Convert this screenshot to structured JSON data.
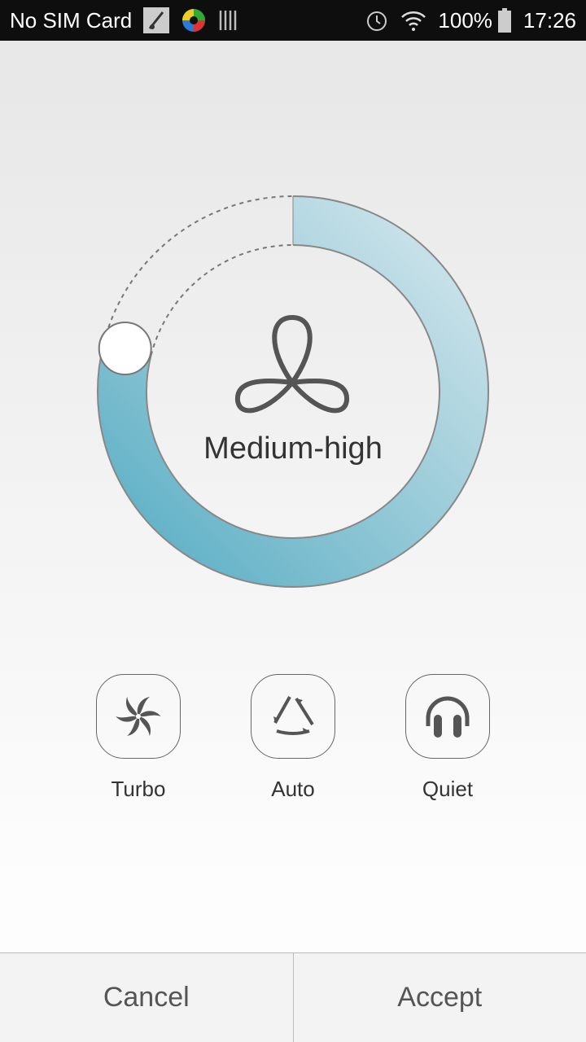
{
  "status_bar": {
    "carrier": "No SIM Card",
    "battery": "100%",
    "time": "17:26",
    "icons": [
      "app-notification-icon",
      "chrome-icon",
      "barcode-icon",
      "alarm-icon",
      "wifi-icon",
      "battery-icon"
    ]
  },
  "fan": {
    "level_label": "Medium-high",
    "level_fraction": 0.79,
    "accent_start": "#d3e6ec",
    "accent_end": "#5aaec4"
  },
  "modes": [
    {
      "label": "Turbo",
      "icon": "turbo-fan-icon"
    },
    {
      "label": "Auto",
      "icon": "auto-cycle-icon"
    },
    {
      "label": "Quiet",
      "icon": "headphones-icon"
    }
  ],
  "footer": {
    "cancel": "Cancel",
    "accept": "Accept"
  }
}
